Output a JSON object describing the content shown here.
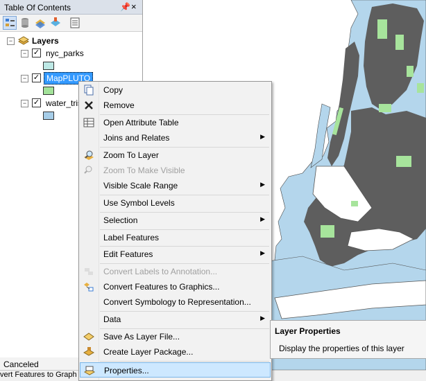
{
  "toc": {
    "title": "Table Of Contents",
    "pin_glyph": "⬭",
    "close_glyph": "×",
    "toolbar": [
      "list-by-drawing-order-icon",
      "list-by-source-icon",
      "list-by-visibility-icon",
      "list-by-selection-icon",
      "options-icon"
    ],
    "tree": {
      "root_label": "Layers",
      "layers": [
        {
          "name": "nyc_parks",
          "checked": true,
          "swatch": "#bde8e5"
        },
        {
          "name": "MapPLUTO",
          "checked": true,
          "swatch": "#a3e29a",
          "selected": true
        },
        {
          "name": "water_tris",
          "checked": true,
          "swatch": "#a6cde8"
        }
      ]
    },
    "status": "Canceled"
  },
  "bottom_status": "vert Features to Graph",
  "context_menu": {
    "items": [
      {
        "label": "Copy",
        "icon": "copy-icon"
      },
      {
        "label": "Remove",
        "icon": "remove-icon"
      },
      {
        "label": "Open Attribute Table",
        "icon": "table-icon"
      },
      {
        "label": "Joins and Relates",
        "submenu": true
      },
      {
        "label": "Zoom To Layer",
        "icon": "zoom-to-layer-icon"
      },
      {
        "label": "Zoom To Make Visible",
        "icon": "zoom-to-visible-icon",
        "disabled": true
      },
      {
        "label": "Visible Scale Range",
        "submenu": true
      },
      {
        "label": "Use Symbol Levels"
      },
      {
        "label": "Selection",
        "submenu": true
      },
      {
        "label": "Label Features"
      },
      {
        "label": "Edit Features",
        "submenu": true
      },
      {
        "label": "Convert Labels to Annotation...",
        "icon": "convert-labels-icon",
        "disabled": true
      },
      {
        "label": "Convert Features to Graphics...",
        "icon": "convert-graphics-icon"
      },
      {
        "label": "Convert Symbology to Representation..."
      },
      {
        "label": "Data",
        "submenu": true
      },
      {
        "label": "Save As Layer File...",
        "icon": "layer-file-icon"
      },
      {
        "label": "Create Layer Package...",
        "icon": "layer-package-icon"
      },
      {
        "label": "Properties...",
        "icon": "properties-icon",
        "highlighted": true
      }
    ],
    "submenu_arrow": "▶"
  },
  "tooltip": {
    "title": "Layer Properties",
    "description": "Display the properties of this layer"
  },
  "colors": {
    "map_land": "#5e5e5e",
    "map_water": "#b4d6ec",
    "map_park": "#a7e49c"
  }
}
